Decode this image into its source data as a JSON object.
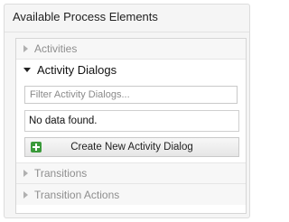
{
  "panel": {
    "title": "Available Process Elements"
  },
  "accordion": {
    "activities": {
      "label": "Activities",
      "expanded": false
    },
    "activity_dialogs": {
      "label": "Activity Dialogs",
      "expanded": true,
      "filter_placeholder": "Filter Activity Dialogs...",
      "filter_value": "",
      "empty_text": "No data found.",
      "create_button_label": "Create New Activity Dialog"
    },
    "transitions": {
      "label": "Transitions",
      "expanded": false
    },
    "transition_actions": {
      "label": "Transition Actions",
      "expanded": false
    }
  },
  "icons": {
    "collapsed": "arrow-right-icon",
    "expanded": "arrow-down-icon",
    "create": "plus-icon"
  },
  "colors": {
    "create_icon_bg": "#3a9a3a",
    "collapsed_text": "#8e8e8e"
  }
}
